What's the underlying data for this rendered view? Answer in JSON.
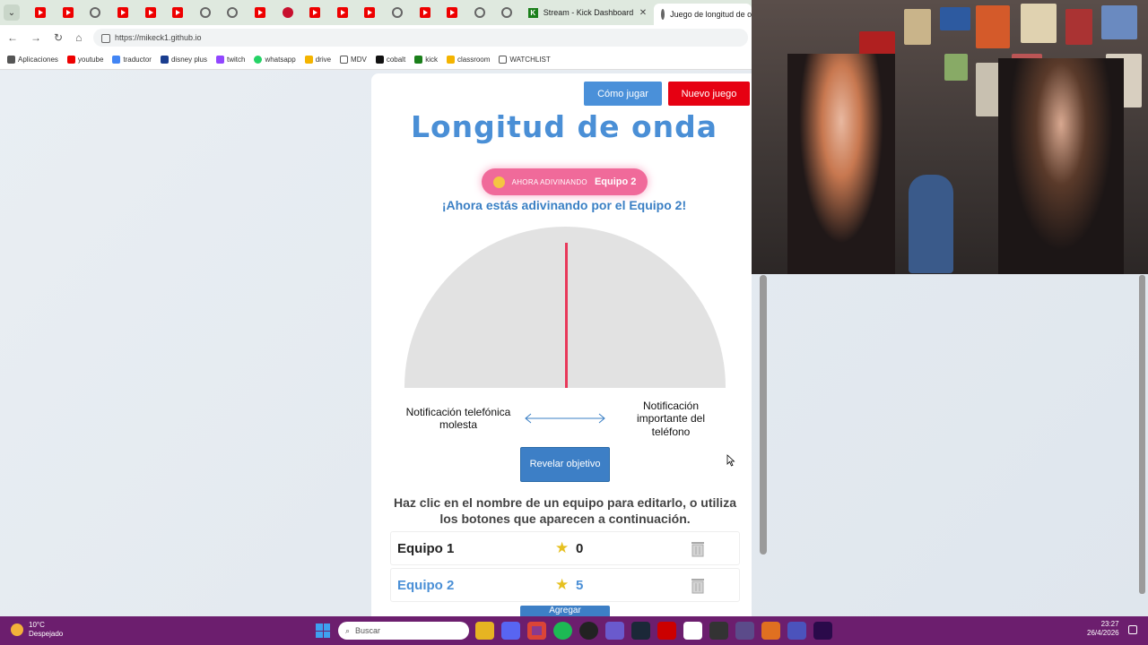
{
  "browser": {
    "tabs": {
      "kick_tab": "Stream - Kick Dashboard",
      "active_tab": "Juego de longitud de o"
    },
    "url": "https://mikeck1.github.io",
    "bookmarks": [
      {
        "label": "Aplicaciones",
        "icon": "apps-grid-icon"
      },
      {
        "label": "youtube",
        "icon": "youtube-icon"
      },
      {
        "label": "traductor",
        "icon": "translate-icon"
      },
      {
        "label": "disney plus",
        "icon": "disney-icon"
      },
      {
        "label": "twitch",
        "icon": "twitch-icon"
      },
      {
        "label": "whatsapp",
        "icon": "whatsapp-icon"
      },
      {
        "label": "drive",
        "icon": "drive-icon"
      },
      {
        "label": "MDV",
        "icon": "folder-icon"
      },
      {
        "label": "cobalt",
        "icon": "cobalt-icon"
      },
      {
        "label": "kick",
        "icon": "kick-icon"
      },
      {
        "label": "classroom",
        "icon": "classroom-icon"
      },
      {
        "label": "WATCHLIST",
        "icon": "folder-icon"
      }
    ]
  },
  "game": {
    "how_to_play": "Cómo jugar",
    "new_game": "Nuevo juego",
    "title": "Longitud de onda",
    "guessing_label": "AHORA ADIVINANDO",
    "guessing_team": "Equipo 2",
    "subtitle": "¡Ahora estás adivinando por el Equipo 2!",
    "left_label": "Notificación telefónica molesta",
    "right_label": "Notificación importante del teléfono",
    "reveal_button": "Revelar objetivo",
    "hint": "Haz clic en el nombre de un equipo para editarlo, o utiliza los botones que aparecen a continuación.",
    "teams": [
      {
        "name": "Equipo 1",
        "score": "0"
      },
      {
        "name": "Equipo 2",
        "score": "5"
      }
    ],
    "add_button": "Agregar"
  },
  "colors": {
    "title_blue": "#4a8fd6",
    "new_game_red": "#e60012",
    "pill_pink": "#f06a9a",
    "needle_red": "#e8385a",
    "taskbar_purple": "#6c1e6e"
  },
  "taskbar": {
    "temperature": "10°C",
    "weather": "Despejado",
    "search_placeholder": "Buscar",
    "time": "23:27",
    "date": "26/4/2026"
  }
}
